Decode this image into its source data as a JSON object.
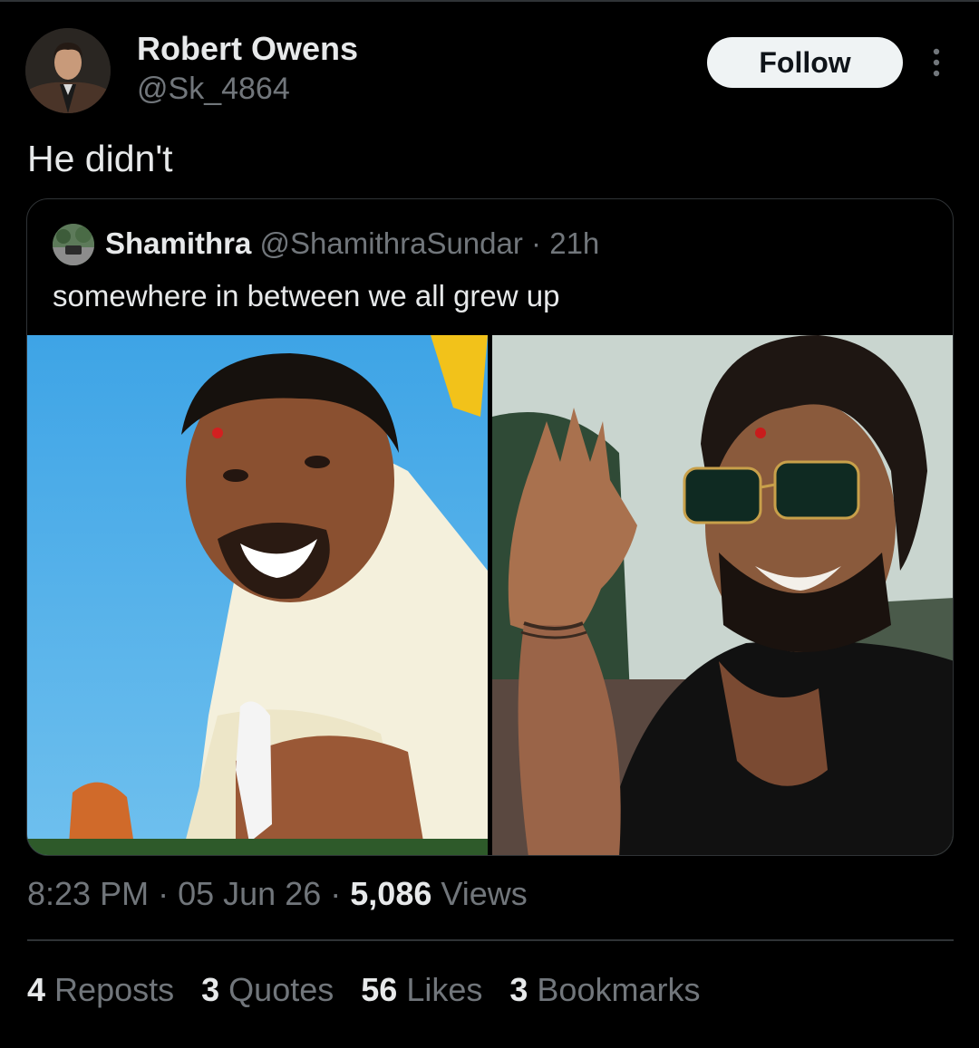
{
  "author": {
    "display_name": "Robert Owens",
    "handle": "@Sk_4864",
    "avatar_icon": "user-avatar-photo"
  },
  "actions": {
    "follow_label": "Follow",
    "more_icon": "more-vertical-icon"
  },
  "tweet": {
    "text": "He didn't"
  },
  "quoted_tweet": {
    "display_name": "Shamithra",
    "handle": "@ShamithraSundar",
    "separator": "·",
    "time": "21h",
    "text": "somewhere in between we all grew up",
    "media": [
      {
        "name": "left-photo",
        "description_icon": "photo-image"
      },
      {
        "name": "right-photo",
        "description_icon": "photo-image"
      }
    ]
  },
  "meta": {
    "time": "8:23 PM",
    "date": "05 Jun 26",
    "views_count": "5,086",
    "views_label": "Views",
    "sep": "·"
  },
  "stats": [
    {
      "count": "4",
      "label": "Reposts"
    },
    {
      "count": "3",
      "label": "Quotes"
    },
    {
      "count": "56",
      "label": "Likes"
    },
    {
      "count": "3",
      "label": "Bookmarks"
    }
  ],
  "colors": {
    "background": "#000000",
    "primary_text": "#e7e9ea",
    "secondary_text": "#71767b",
    "border": "#2f3336",
    "follow_bg": "#eff3f4"
  }
}
